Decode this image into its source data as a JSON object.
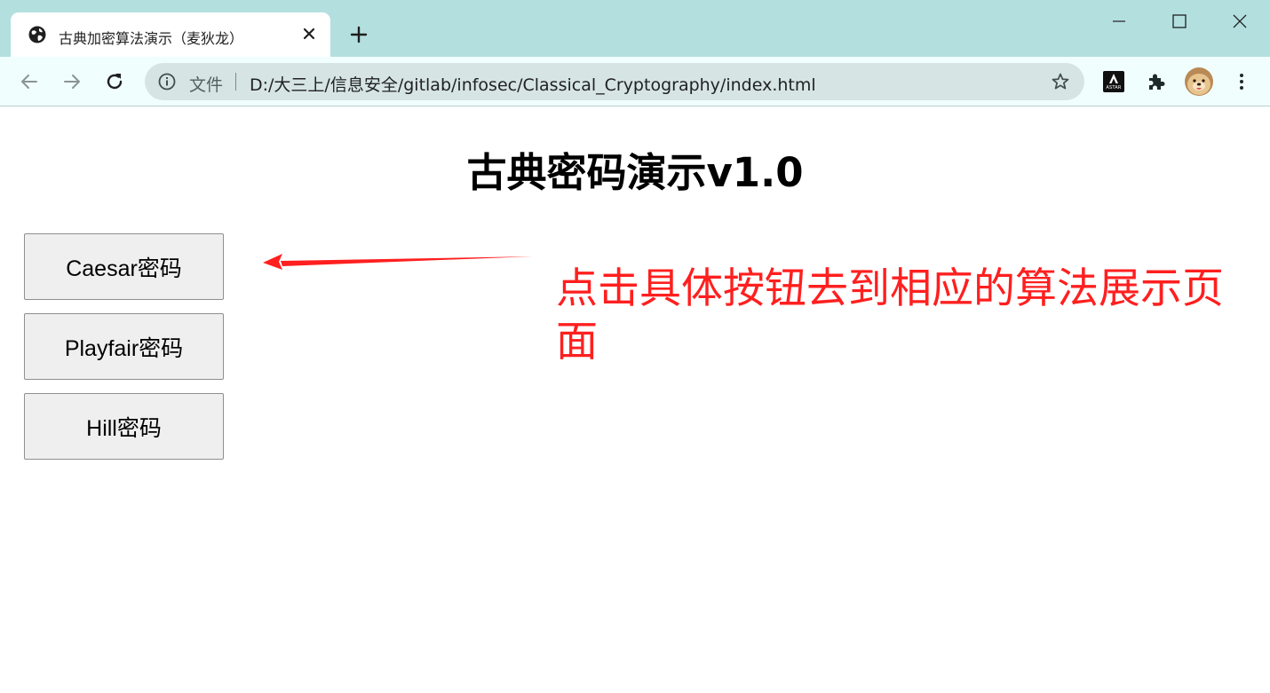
{
  "browser": {
    "tab": {
      "title": "古典加密算法演示（麦狄龙）"
    },
    "omnibox": {
      "scheme_label": "文件",
      "url": "D:/大三上/信息安全/gitlab/infosec/Classical_Cryptography/index.html"
    },
    "extensions": {
      "astar_label": "ASTAR"
    },
    "colors": {
      "titlebar": "#b3dfdf",
      "toolbar": "#f1fefe",
      "omnibox": "#d6e4e4"
    }
  },
  "page": {
    "title": "古典密码演示v1.0",
    "buttons": [
      {
        "label": "Caesar密码"
      },
      {
        "label": "Playfair密码"
      },
      {
        "label": "Hill密码"
      }
    ],
    "annotation": {
      "text": "点击具体按钮去到相应的算法展示页面",
      "color": "#ff1f1f"
    }
  }
}
